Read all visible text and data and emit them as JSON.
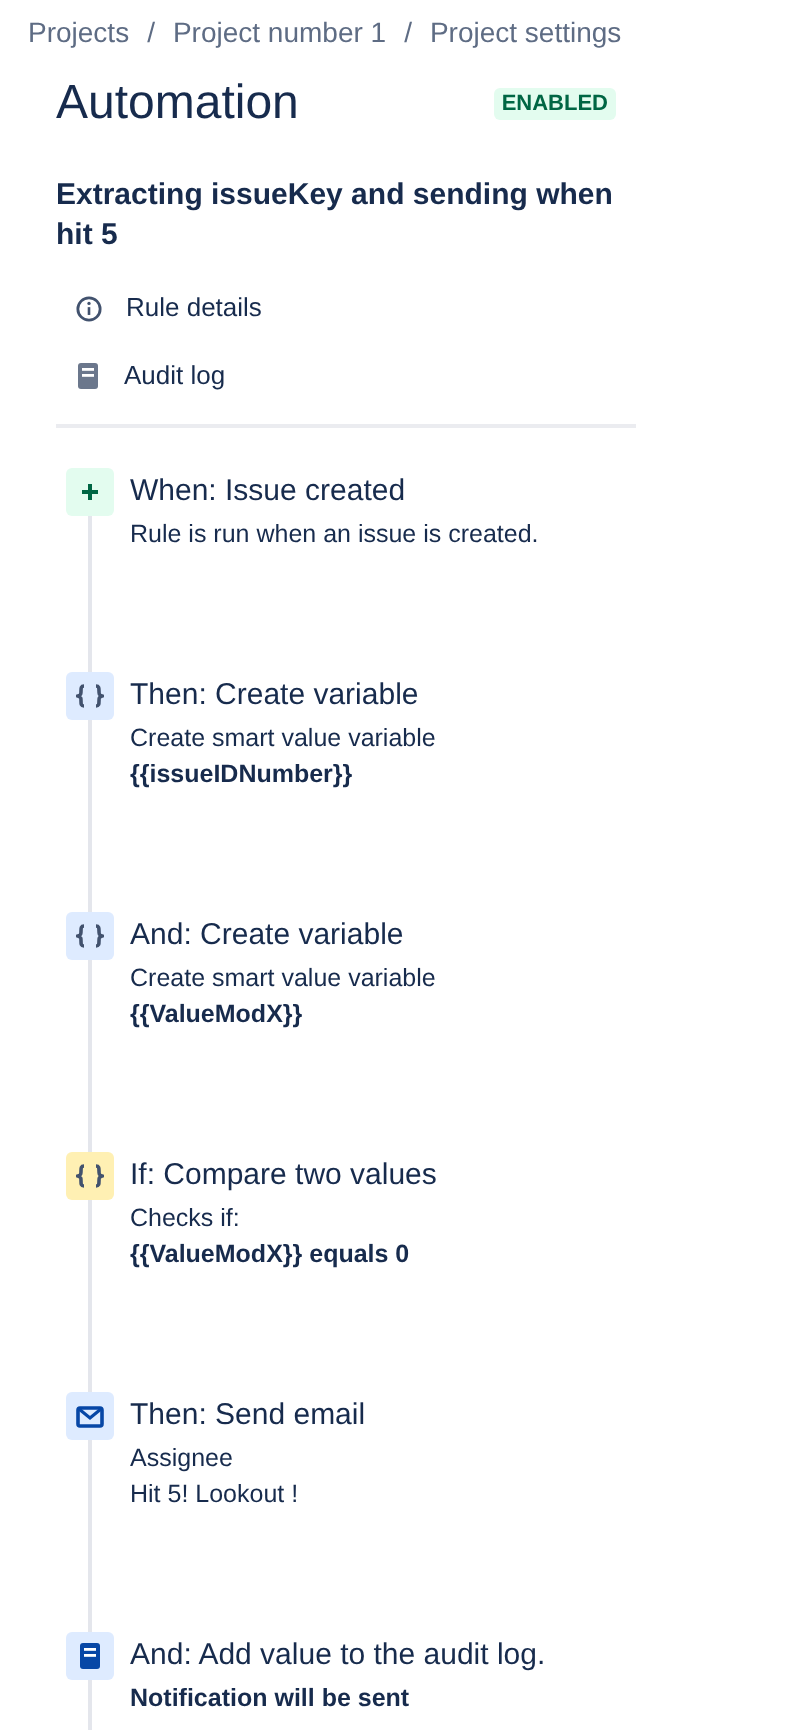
{
  "breadcrumbs": [
    {
      "label": "Projects",
      "separator": "/"
    },
    {
      "label": "Project number 1",
      "separator": "/"
    },
    {
      "label": "Project settings"
    }
  ],
  "title": "Automation",
  "status": {
    "label": "ENABLED",
    "kind": "enabled"
  },
  "rule_name": "Extracting issueKey and sending when hit 5",
  "menu": [
    {
      "label": "Rule details",
      "kind": "info"
    },
    {
      "label": "Audit log",
      "kind": "log"
    }
  ],
  "steps": [
    {
      "kind": "trigger",
      "title": "When: Issue created",
      "lines": [
        {
          "text": "Rule is run when an issue is created.",
          "bold": false
        }
      ]
    },
    {
      "kind": "variable",
      "title": "Then: Create variable",
      "lines": [
        {
          "text": "Create smart value variable",
          "bold": false
        },
        {
          "text": "{{issueIDNumber}}",
          "bold": true
        }
      ]
    },
    {
      "kind": "variable",
      "title": "And: Create variable",
      "lines": [
        {
          "text": "Create smart value variable",
          "bold": false
        },
        {
          "text": "{{ValueModX}}",
          "bold": true
        }
      ]
    },
    {
      "kind": "condition",
      "title": "If: Compare two values",
      "lines": [
        {
          "text": "Checks if:",
          "bold": false
        },
        {
          "text": "{{ValueModX}} equals 0",
          "bold": true
        }
      ]
    },
    {
      "kind": "email",
      "title": "Then: Send email",
      "lines": [
        {
          "text": "Assignee",
          "bold": false
        },
        {
          "text": "Hit 5! Lookout !",
          "bold": false
        }
      ]
    },
    {
      "kind": "log",
      "title": "And: Add value to the audit log.",
      "lines": [
        {
          "text": "Notification will be sent",
          "bold": true
        }
      ]
    }
  ]
}
